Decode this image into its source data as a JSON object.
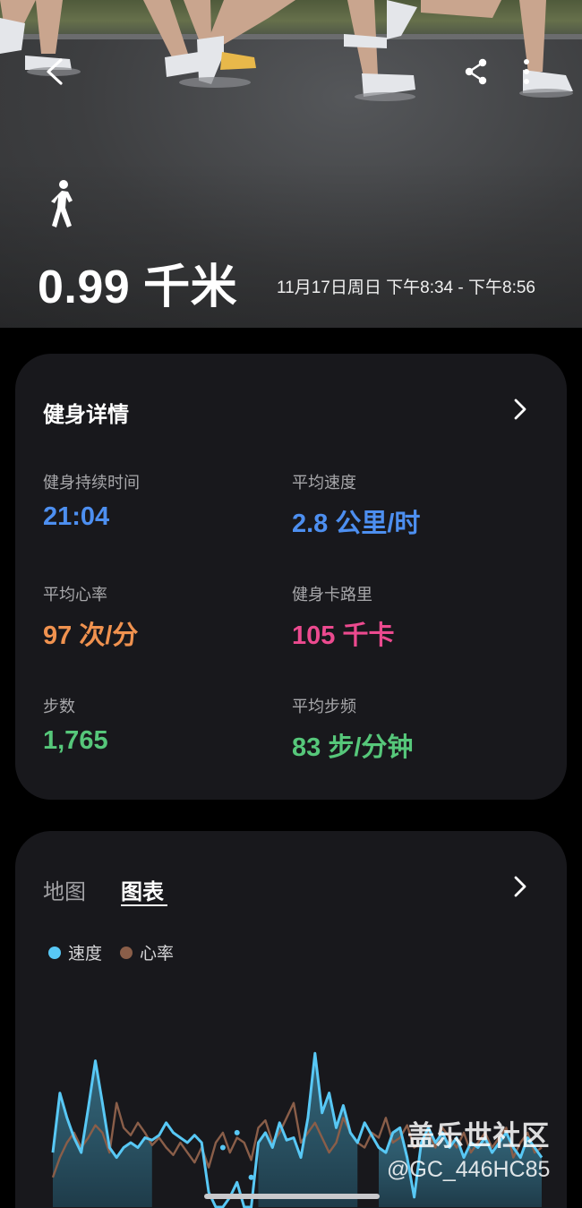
{
  "hero": {
    "activity_icon": "walking-person-icon",
    "distance": "0.99 千米",
    "date_range": "11月17日周日 下午8:34 - 下午8:56",
    "back_icon": "back-arrow-icon",
    "share_icon": "share-icon",
    "more_icon": "more-vertical-icon"
  },
  "details": {
    "title": "健身详情",
    "metrics": [
      {
        "label": "健身持续时间",
        "value": "21:04",
        "color": "#4d8ff0"
      },
      {
        "label": "平均速度",
        "value": "2.8 公里/时",
        "color": "#4d8ff0"
      },
      {
        "label": "平均心率",
        "value": "97 次/分",
        "color": "#f0924f"
      },
      {
        "label": "健身卡路里",
        "value": "105 千卡",
        "color": "#ec4a8f"
      },
      {
        "label": "步数",
        "value": "1,765",
        "color": "#56c77a"
      },
      {
        "label": "平均步频",
        "value": "83 步/分钟",
        "color": "#56c77a"
      }
    ]
  },
  "chart_section": {
    "tabs": [
      {
        "label": "地图",
        "active": false
      },
      {
        "label": "图表",
        "active": true
      }
    ],
    "legend": [
      {
        "label": "速度",
        "color": "#58c8f5"
      },
      {
        "label": "心率",
        "color": "#8a5e49"
      }
    ]
  },
  "chart_data": {
    "type": "line",
    "series": [
      {
        "name": "速度",
        "color": "#58c8f5",
        "values": [
          2.2,
          4.6,
          3.6,
          2.8,
          2.2,
          4.0,
          5.9,
          4.2,
          2.4,
          2.0,
          2.4,
          2.6,
          2.4,
          2.8,
          2.7,
          2.9,
          3.4,
          3.0,
          2.8,
          2.6,
          2.9,
          2.6,
          0.6,
          0.0,
          0.0,
          0.4,
          1.0,
          0.0,
          0.0,
          2.6,
          3.0,
          2.4,
          3.4,
          2.7,
          2.8,
          2.0,
          3.6,
          6.2,
          3.8,
          4.6,
          3.2,
          4.1,
          3.0,
          2.6,
          3.4,
          2.9,
          2.4,
          2.2,
          3.0,
          3.2,
          2.0,
          0.4,
          2.6,
          3.2,
          2.6,
          3.0,
          2.4,
          2.8,
          2.0,
          2.6,
          2.4,
          2.8,
          2.2,
          2.6,
          3.0,
          2.4,
          2.0,
          2.8,
          2.4,
          2.0
        ]
      },
      {
        "name": "心率",
        "color": "#8a5e49",
        "values": [
          1.2,
          2.0,
          2.6,
          3.0,
          2.4,
          2.8,
          3.3,
          3.0,
          2.2,
          4.2,
          3.2,
          2.9,
          3.4,
          3.0,
          2.5,
          2.8,
          2.4,
          2.1,
          2.6,
          2.2,
          1.8,
          2.4,
          1.6,
          2.6,
          3.0,
          2.2,
          2.8,
          2.6,
          1.9,
          3.2,
          3.5,
          2.6,
          3.0,
          3.6,
          4.2,
          2.6,
          3.0,
          3.4,
          2.8,
          2.2,
          2.6,
          3.6,
          3.0,
          2.6,
          2.4,
          3.0,
          2.8,
          3.6,
          2.6,
          2.8,
          3.3,
          2.4,
          2.6,
          3.0,
          2.4,
          3.2,
          2.8,
          2.4,
          3.0,
          2.2,
          2.6,
          3.0,
          2.4,
          2.8,
          3.2,
          2.0,
          2.6,
          3.0,
          2.2,
          2.4
        ]
      }
    ],
    "ylim": [
      0,
      6.5
    ],
    "grid": false,
    "legend_position": "top-left"
  },
  "watermark": {
    "line1": "盖乐世社区",
    "line2": "@GC_446HC85"
  }
}
